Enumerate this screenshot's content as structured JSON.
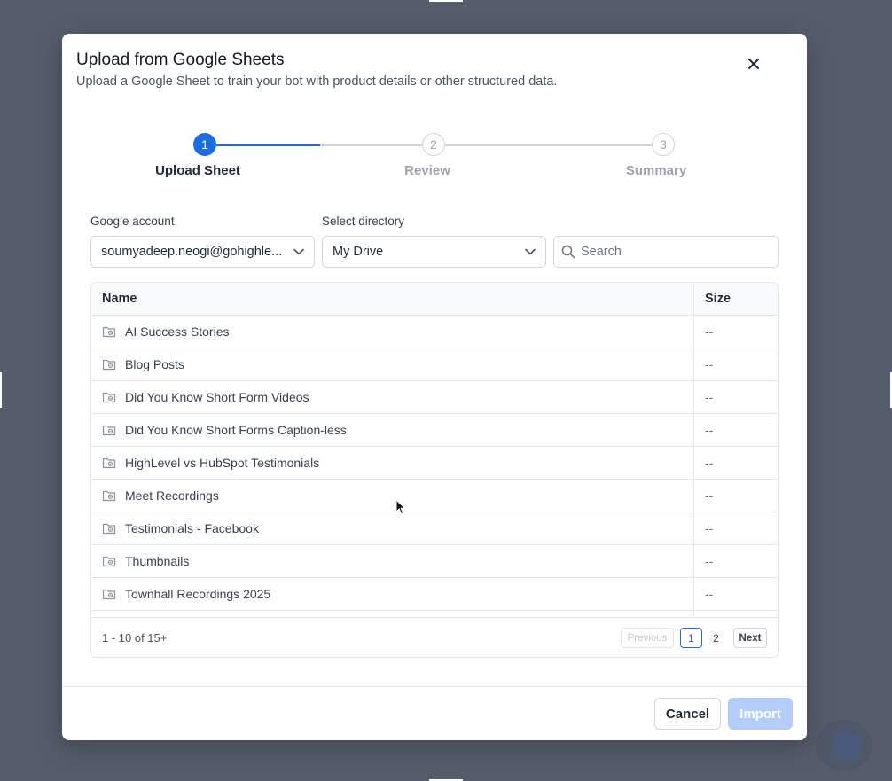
{
  "modal": {
    "title": "Upload from Google Sheets",
    "subtitle": "Upload a Google Sheet to train your bot with product details or other structured data.",
    "close_icon": "close-icon"
  },
  "stepper": {
    "steps": [
      {
        "number": "1",
        "label": "Upload Sheet",
        "active": true
      },
      {
        "number": "2",
        "label": "Review",
        "active": false
      },
      {
        "number": "3",
        "label": "Summary",
        "active": false
      }
    ],
    "active_color": "#1d6ae5"
  },
  "form": {
    "account_label": "Google account",
    "account_value": "soumyadeep.neogi@gohighle...",
    "directory_label": "Select directory",
    "directory_value": "My Drive",
    "search_placeholder": "Search"
  },
  "table": {
    "columns": [
      "Name",
      "Size"
    ],
    "rows": [
      {
        "name": "AI Success Stories",
        "size": "--"
      },
      {
        "name": "Blog Posts",
        "size": "--"
      },
      {
        "name": "Did You Know Short Form Videos",
        "size": "--"
      },
      {
        "name": "Did You Know Short Forms Caption-less",
        "size": "--"
      },
      {
        "name": "HighLevel vs HubSpot Testimonials",
        "size": "--"
      },
      {
        "name": "Meet Recordings",
        "size": "--"
      },
      {
        "name": "Testimonials - Facebook",
        "size": "--"
      },
      {
        "name": "Thumbnails",
        "size": "--"
      },
      {
        "name": "Townhall Recordings 2025",
        "size": "--"
      }
    ],
    "row_icon": "shared-folder-icon"
  },
  "pagination": {
    "range": "1 - 10 of 15+",
    "previous": "Previous",
    "pages": [
      "1",
      "2"
    ],
    "current_page": "1",
    "next": "Next"
  },
  "footer": {
    "cancel": "Cancel",
    "import": "Import"
  }
}
